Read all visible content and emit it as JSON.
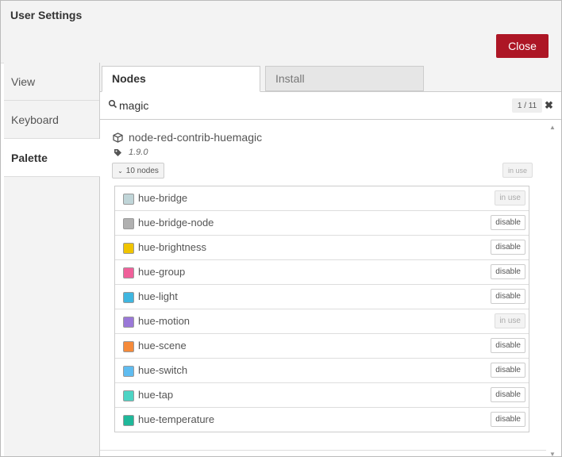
{
  "dialog": {
    "title": "User Settings",
    "close_label": "Close"
  },
  "sidebar": {
    "items": [
      {
        "label": "View",
        "active": false
      },
      {
        "label": "Keyboard",
        "active": false
      },
      {
        "label": "Palette",
        "active": true
      }
    ]
  },
  "tabs": [
    {
      "label": "Nodes",
      "active": true
    },
    {
      "label": "Install",
      "active": false
    }
  ],
  "search": {
    "value": "magic",
    "count": "1 / 11"
  },
  "package": {
    "name": "node-red-contrib-huemagic",
    "version": "1.9.0",
    "nodes_toggle": "10 nodes",
    "status": "in use"
  },
  "nodes": [
    {
      "name": "hue-bridge",
      "color": "#c0d5d8",
      "action": "in use"
    },
    {
      "name": "hue-bridge-node",
      "color": "#b0b0b0",
      "action": "disable"
    },
    {
      "name": "hue-brightness",
      "color": "#f0c400",
      "action": "disable"
    },
    {
      "name": "hue-group",
      "color": "#f0609a",
      "action": "disable"
    },
    {
      "name": "hue-light",
      "color": "#3fb6e0",
      "action": "disable"
    },
    {
      "name": "hue-motion",
      "color": "#9a78d8",
      "action": "in use"
    },
    {
      "name": "hue-scene",
      "color": "#f58a3a",
      "action": "disable"
    },
    {
      "name": "hue-switch",
      "color": "#5fbcf0",
      "action": "disable"
    },
    {
      "name": "hue-tap",
      "color": "#4dd4c4",
      "action": "disable"
    },
    {
      "name": "hue-temperature",
      "color": "#1fb89a",
      "action": "disable"
    }
  ],
  "icons": {
    "search": "search-icon",
    "clear": "close-icon",
    "package": "cube-icon",
    "version": "tag-icon",
    "toggle": "chevron-down-icon"
  }
}
